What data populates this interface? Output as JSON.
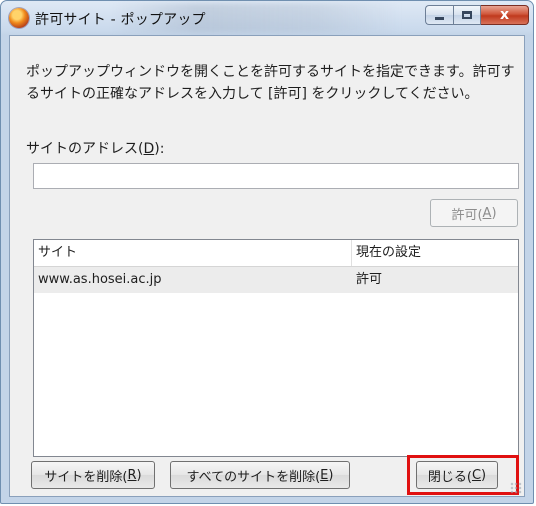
{
  "window": {
    "title": "許可サイト - ポップアップ",
    "app_icon": "firefox-icon",
    "controls": {
      "minimize": "minimize-icon",
      "maximize": "maximize-icon",
      "close_label": "x"
    }
  },
  "description": "ポップアップウィンドウを開くことを許可するサイトを指定できます。許可するサイトの正確なアドレスを入力して [許可] をクリックしてください。",
  "address": {
    "label_prefix": "サイトのアドレス(",
    "label_key": "D",
    "label_suffix": "):",
    "value": ""
  },
  "allow_button": {
    "prefix": "許可(",
    "key": "A",
    "suffix": ")"
  },
  "sites_table": {
    "columns": [
      "サイト",
      "現在の設定"
    ],
    "rows": [
      {
        "site": "www.as.hosei.ac.jp",
        "status": "許可"
      }
    ]
  },
  "buttons": {
    "remove_site": {
      "prefix": "サイトを削除(",
      "key": "R",
      "suffix": ")"
    },
    "remove_all": {
      "prefix": "すべてのサイトを削除(",
      "key": "E",
      "suffix": ")"
    },
    "close": {
      "prefix": "閉じる(",
      "key": "C",
      "suffix": ")"
    }
  },
  "highlight_color": "#e01010"
}
